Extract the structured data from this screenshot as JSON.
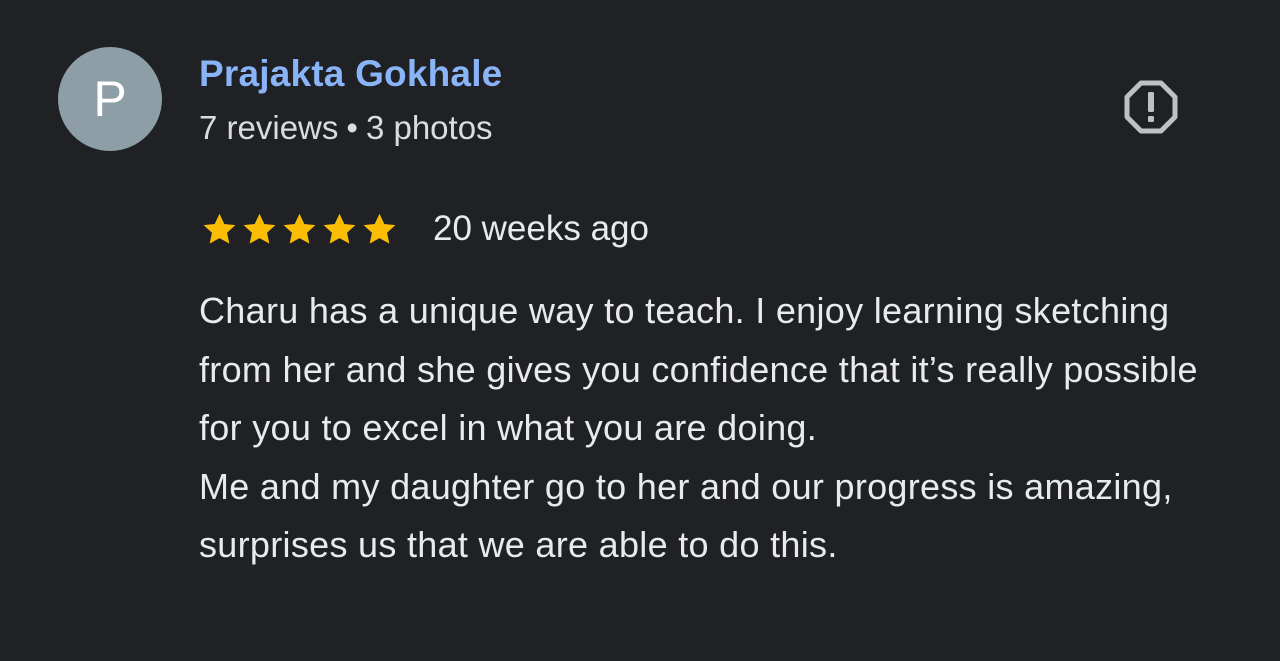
{
  "reviewer": {
    "avatar_letter": "P",
    "name": "Prajakta Gokhale",
    "reviews_count": "7 reviews",
    "separator": "•",
    "photos_count": "3 photos"
  },
  "review": {
    "rating": 5,
    "max_rating": 5,
    "time_ago": "20 weeks ago",
    "paragraphs": [
      "Charu has a unique way to teach. I enjoy learning sketching from her and she gives you confidence that it’s really possible for you to excel in what you are doing.",
      "Me and my daughter go to her and our progress is amazing, surprises us that we are able to do this."
    ]
  },
  "actions": {
    "report_icon": "report-flag-icon"
  },
  "colors": {
    "background": "#202124",
    "name_link": "#8ab4f8",
    "star": "#fbbc04",
    "avatar_bg": "#8e9ea6",
    "text": "#e8eaed"
  }
}
